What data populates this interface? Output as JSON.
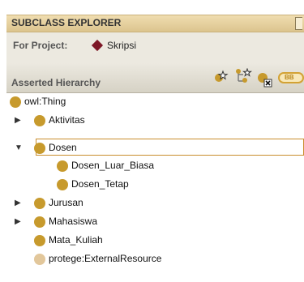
{
  "panel": {
    "title": "SUBCLASS EXPLORER",
    "project_label": "For Project:",
    "project_name": "Skripsi",
    "hierarchy_label": "Asserted Hierarchy",
    "tool_badge": "BB"
  },
  "tree": [
    {
      "label": "owl:Thing",
      "expandable": false,
      "selected": false
    },
    {
      "label": "Aktivitas",
      "expandable": true,
      "expanded": false,
      "selected": false
    },
    {
      "label": "Dosen",
      "expandable": true,
      "expanded": true,
      "selected": true
    },
    {
      "label": "Dosen_Luar_Biasa",
      "expandable": false,
      "selected": false
    },
    {
      "label": "Dosen_Tetap",
      "expandable": false,
      "selected": false
    },
    {
      "label": "Jurusan",
      "expandable": true,
      "expanded": false,
      "selected": false
    },
    {
      "label": "Mahasiswa",
      "expandable": true,
      "expanded": false,
      "selected": false
    },
    {
      "label": "Mata_Kuliah",
      "expandable": false,
      "selected": false
    },
    {
      "label": "protege:ExternalResource",
      "expandable": false,
      "selected": false
    }
  ],
  "colors": {
    "class_icon": "#c79a2d",
    "external_icon": "#e2c79b",
    "project_icon": "#7d1726",
    "selection_border": "#c98d2d"
  }
}
